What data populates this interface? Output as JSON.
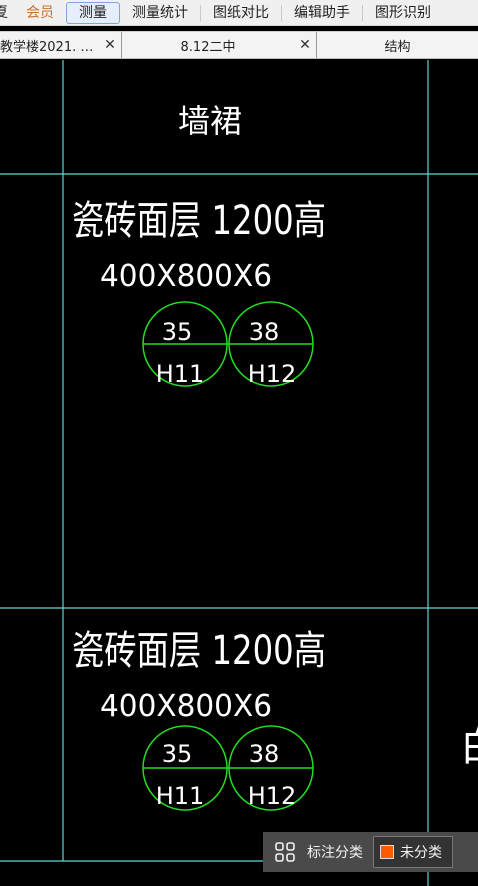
{
  "menu": {
    "items": [
      {
        "label": "夏"
      },
      {
        "label": "会员"
      },
      {
        "label": "测量"
      },
      {
        "label": "测量统计"
      },
      {
        "label": "图纸对比"
      },
      {
        "label": "编辑助手"
      },
      {
        "label": "图形识别"
      }
    ]
  },
  "tabs": [
    {
      "label": "教学楼2021. …",
      "close": "✕"
    },
    {
      "label": "8.12二中",
      "close": "✕"
    },
    {
      "label": "结构"
    }
  ],
  "drawing": {
    "header": "墙裙",
    "blocks": [
      {
        "title": "瓷砖面层 1200高",
        "size": "400X800X6",
        "circles": [
          {
            "top": "35",
            "bottom": "H11"
          },
          {
            "top": "38",
            "bottom": "H12"
          }
        ]
      },
      {
        "title": "瓷砖面层 1200高",
        "size": "400X800X6",
        "circles": [
          {
            "top": "35",
            "bottom": "H11"
          },
          {
            "top": "38",
            "bottom": "H12"
          }
        ]
      }
    ],
    "partial_text": "白"
  },
  "panel": {
    "label": "标注分类",
    "category": "未分类",
    "category_color": "#ff5a00"
  },
  "colors": {
    "grid_line": "#5fd7d7",
    "text": "#ffffff",
    "circle": "#22dd22"
  }
}
